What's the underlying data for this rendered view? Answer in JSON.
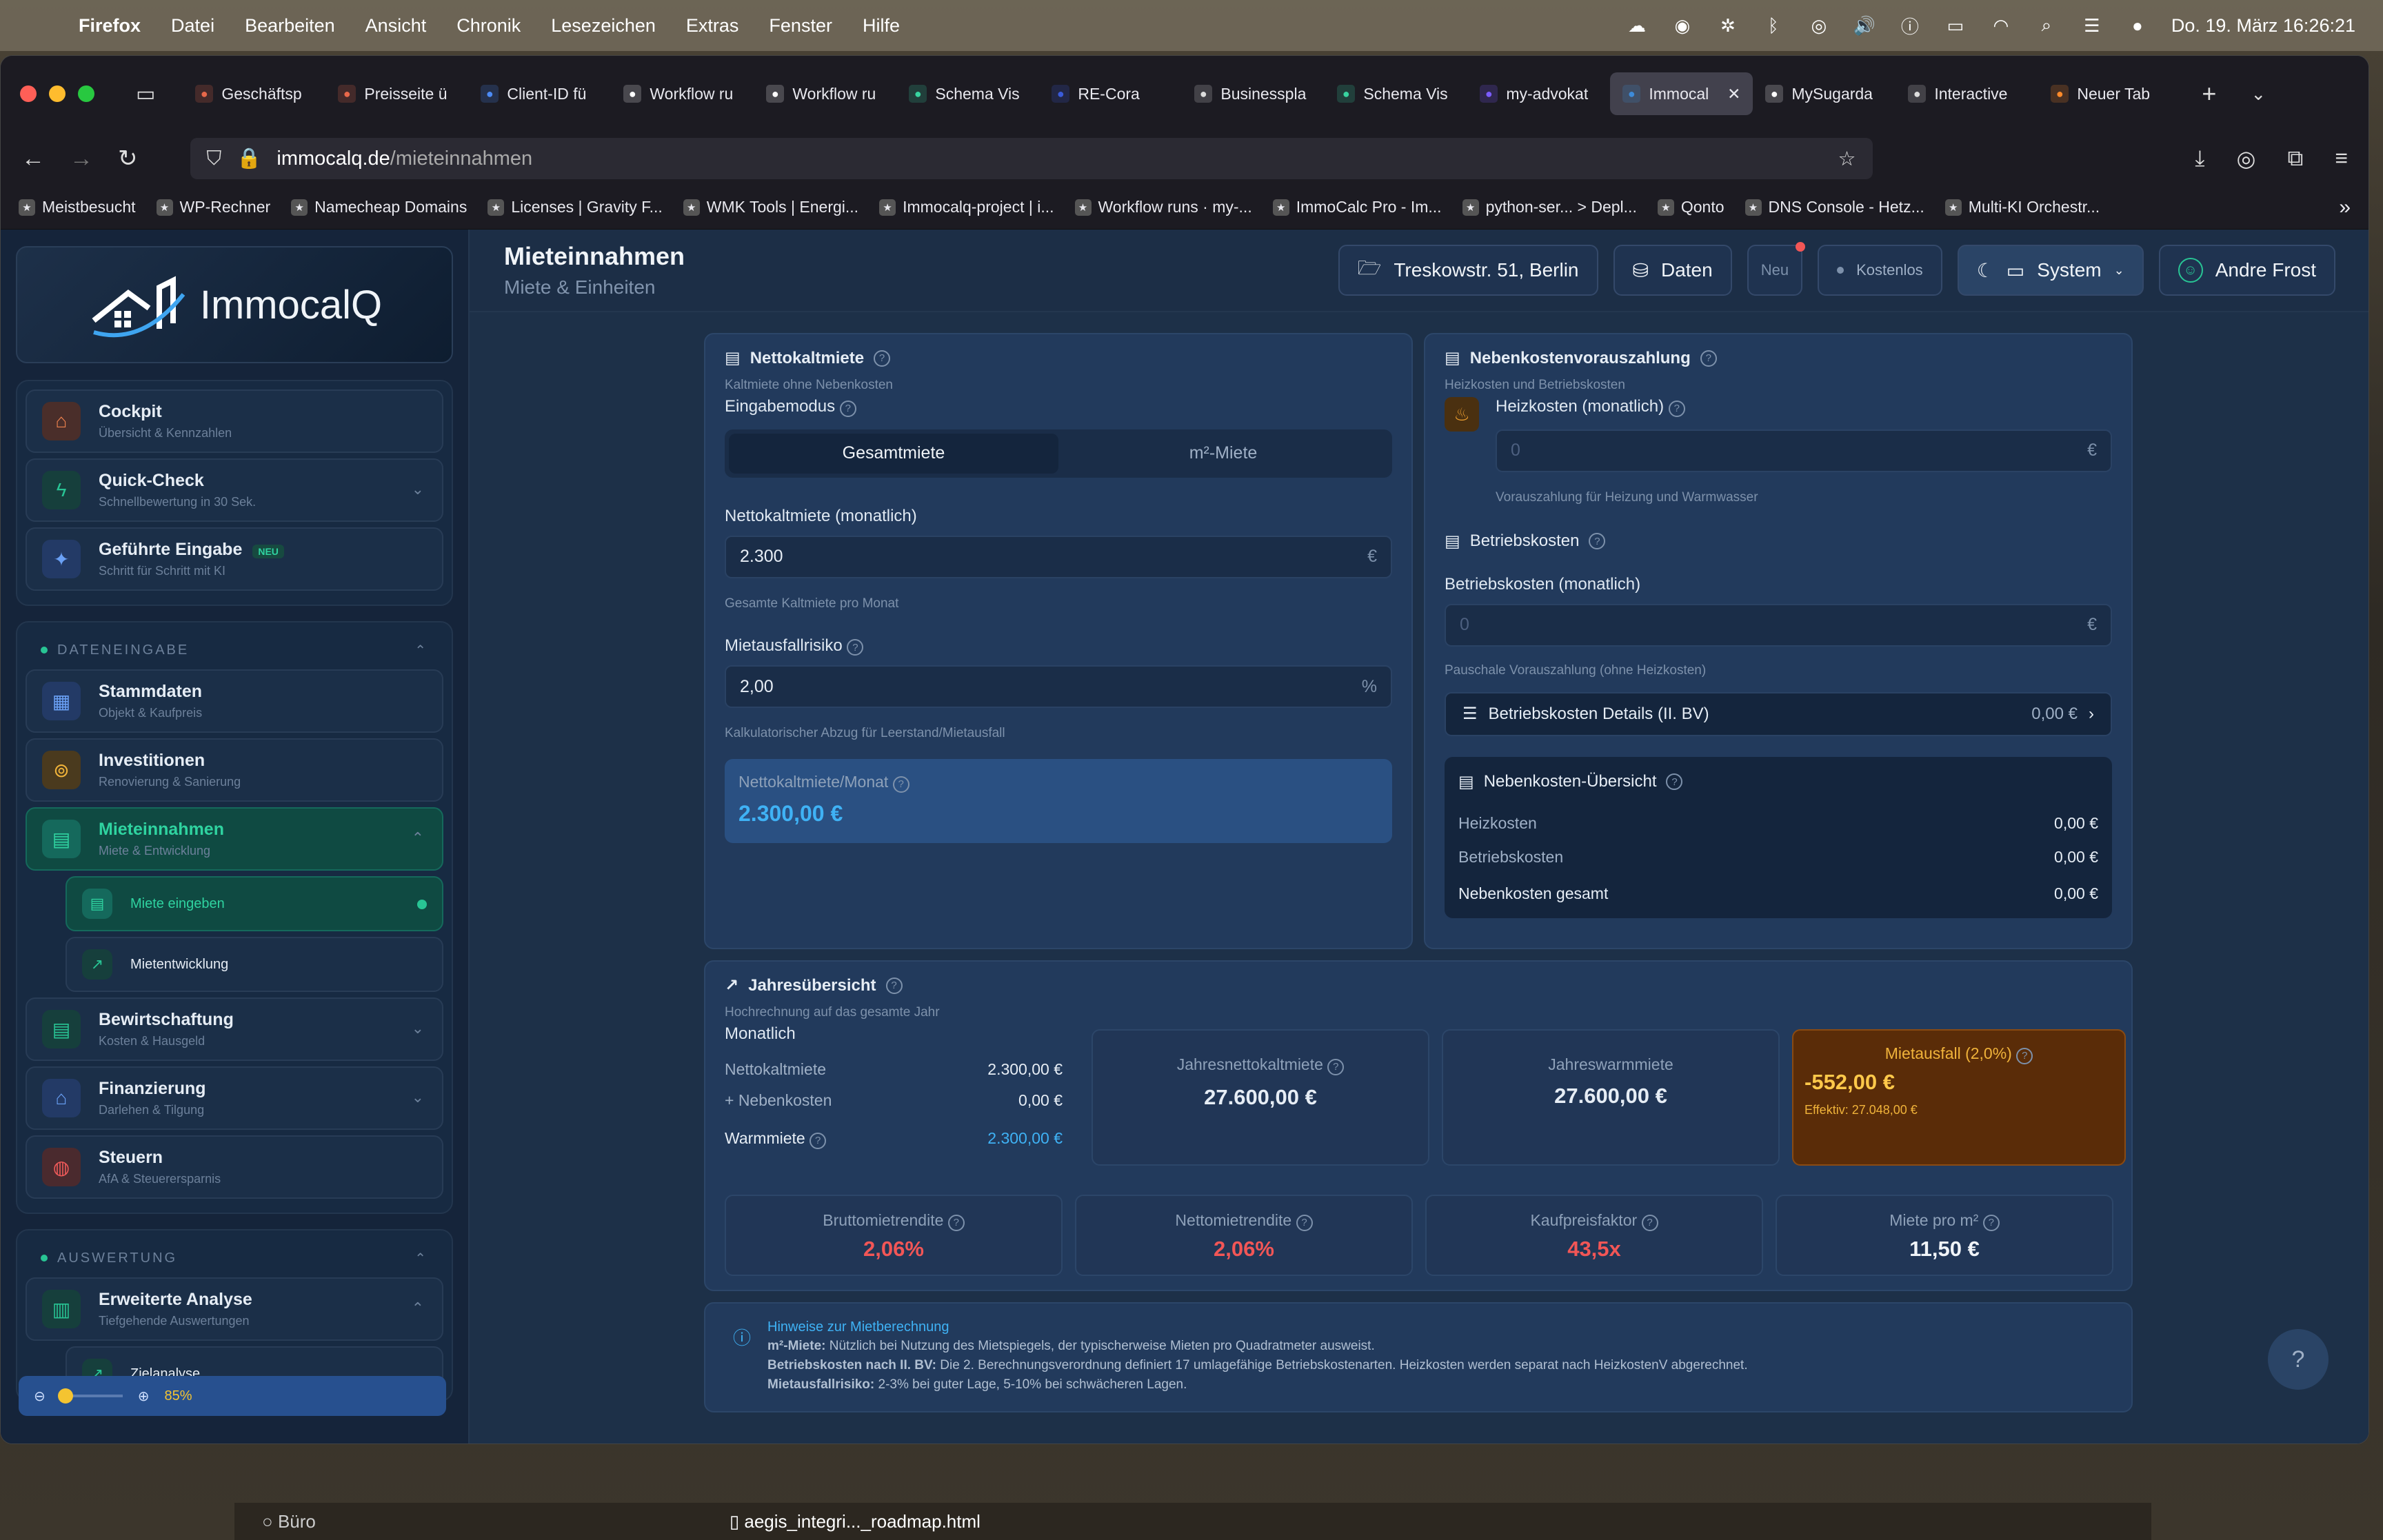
{
  "menubar": {
    "app": "Firefox",
    "items": [
      "Datei",
      "Bearbeiten",
      "Ansicht",
      "Chronik",
      "Lesezeichen",
      "Extras",
      "Fenster",
      "Hilfe"
    ],
    "clock": "Do. 19. März  16:26:21"
  },
  "tabs": [
    {
      "label": "Geschäftsp",
      "color": "#e8684a"
    },
    {
      "label": "Preisseite ü",
      "color": "#e8684a"
    },
    {
      "label": "Client-ID fü",
      "color": "#4c8bf5"
    },
    {
      "label": "Workflow ru",
      "color": "#ffffff"
    },
    {
      "label": "Workflow ru",
      "color": "#ffffff"
    },
    {
      "label": "Schema Vis",
      "color": "#38d39f"
    },
    {
      "label": "RE-Cora",
      "color": "#3a5bd9"
    },
    {
      "label": "Businesspla",
      "color": "#dddddd"
    },
    {
      "label": "Schema Vis",
      "color": "#38d39f"
    },
    {
      "label": "my-advokat",
      "color": "#7b5cff"
    },
    {
      "label": "Immocal",
      "color": "#3d8bd9",
      "active": true
    },
    {
      "label": "MySugarda",
      "color": "#ffffff"
    },
    {
      "label": "Interactive",
      "color": "#dddddd"
    },
    {
      "label": "Neuer Tab",
      "color": "#ff8a2a"
    }
  ],
  "url": {
    "host": "immocalq.de",
    "path": "/mieteinnahmen"
  },
  "bookmarks": [
    "Meistbesucht",
    "WP-Rechner",
    "Namecheap Domains",
    "Licenses | Gravity F...",
    "WMK Tools | Energi...",
    "Immocalq-project | i...",
    "Workflow runs · my-...",
    "ImmoCalc Pro - Im...",
    "python-ser... > Depl...",
    "Qonto",
    "DNS Console - Hetz...",
    "Multi-KI Orchestr..."
  ],
  "sidebar": {
    "logo": "ImmocalQ",
    "top": [
      {
        "title": "Cockpit",
        "sub": "Übersicht & Kennzahlen"
      },
      {
        "title": "Quick-Check",
        "sub": "Schnellbewertung in 30 Sek."
      },
      {
        "title": "Geführte Eingabe",
        "sub": "Schritt für Schritt mit KI",
        "badge": "NEU"
      }
    ],
    "section1": "DATENEINGABE",
    "data": [
      {
        "title": "Stammdaten",
        "sub": "Objekt & Kaufpreis"
      },
      {
        "title": "Investitionen",
        "sub": "Renovierung & Sanierung"
      },
      {
        "title": "Mieteinnahmen",
        "sub": "Miete & Entwicklung"
      },
      {
        "title": "Bewirtschaftung",
        "sub": "Kosten & Hausgeld"
      },
      {
        "title": "Finanzierung",
        "sub": "Darlehen & Tilgung"
      },
      {
        "title": "Steuern",
        "sub": "AfA & Steuerersparnis"
      }
    ],
    "subs": [
      "Miete eingeben",
      "Mietentwicklung"
    ],
    "section2": "AUSWERTUNG",
    "analysis": {
      "title": "Erweiterte Analyse",
      "sub": "Tiefgehende Auswertungen"
    },
    "analysis_sub": "Zielanalyse",
    "zoom": "85%"
  },
  "header": {
    "title": "Mieteinnahmen",
    "subtitle": "Miete & Einheiten",
    "address": "Treskowstr. 51, Berlin",
    "daten": "Daten",
    "neu": "Neu",
    "plan": "Kostenlos",
    "theme": "System",
    "user": "Andre Frost"
  },
  "netto": {
    "title": "Nettokaltmiete",
    "sub": "Kaltmiete ohne Nebenkosten",
    "mode_label": "Eingabemodus",
    "mode_a": "Gesamtmiete",
    "mode_b": "m²-Miete",
    "rent_label": "Nettokaltmiete (monatlich)",
    "rent": "2.300",
    "rent_unit": "€",
    "rent_hint": "Gesamte Kaltmiete pro Monat",
    "risk_label": "Mietausfallrisiko",
    "risk": "2,00",
    "risk_unit": "%",
    "risk_hint": "Kalkulatorischer Abzug für Leerstand/Mietausfall",
    "result_label": "Nettokaltmiete/Monat",
    "result": "2.300,00 €"
  },
  "neben": {
    "title": "Nebenkostenvorauszahlung",
    "sub": "Heizkosten und Betriebskosten",
    "heat_label": "Heizkosten (monatlich)",
    "heat_ph": "0",
    "heat_unit": "€",
    "heat_hint": "Vorauszahlung für Heizung und Warmwasser",
    "betr_title": "Betriebskosten",
    "betr_label": "Betriebskosten (monatlich)",
    "betr_ph": "0",
    "betr_unit": "€",
    "betr_hint": "Pauschale Vorauszahlung (ohne Heizkosten)",
    "details": "Betriebskosten Details (II. BV)",
    "details_val": "0,00 €",
    "ov_title": "Nebenkosten-Übersicht",
    "ov_rows": [
      {
        "k": "Heizkosten",
        "v": "0,00 €"
      },
      {
        "k": "Betriebskosten",
        "v": "0,00 €"
      }
    ],
    "ov_total_k": "Nebenkosten gesamt",
    "ov_total_v": "0,00 €"
  },
  "jahr": {
    "title": "Jahresübersicht",
    "sub": "Hochrechnung auf das gesamte Jahr",
    "monthly": "Monatlich",
    "rows": [
      {
        "k": "Nettokaltmiete",
        "v": "2.300,00 €"
      },
      {
        "k": "+ Nebenkosten",
        "v": "0,00 €"
      }
    ],
    "warm_k": "Warmmiete",
    "warm_v": "2.300,00 €",
    "b1_label": "Jahresnettokaltmiete",
    "b1_val": "27.600,00 €",
    "b2_label": "Jahreswarmmiete",
    "b2_val": "27.600,00 €",
    "b3_label": "Mietausfall (2,0%)",
    "b3_val": "-552,00 €",
    "b3_eff": "Effektiv: 27.048,00 €",
    "k": [
      {
        "label": "Bruttomietrendite",
        "val": "2,06%",
        "color": "#f25656"
      },
      {
        "label": "Nettomietrendite",
        "val": "2,06%",
        "color": "#f25656"
      },
      {
        "label": "Kaufpreisfaktor",
        "val": "43,5x",
        "color": "#f25656"
      },
      {
        "label": "Miete pro m²",
        "val": "11,50 €",
        "color": "#f0f4f8"
      }
    ]
  },
  "hints": {
    "title": "Hinweise zur Mietberechnung",
    "l1b": "m²-Miete:",
    "l1": " Nützlich bei Nutzung des Mietspiegels, der typischerweise Mieten pro Quadratmeter ausweist.",
    "l2b": "Betriebskosten nach II. BV:",
    "l2": " Die 2. Berechnungsverordnung definiert 17 umlagefähige Betriebskostenarten. Heizkosten werden separat nach HeizkostenV abgerechnet.",
    "l3b": "Mietausfallrisiko:",
    "l3": " 2-3% bei guter Lage, 5-10% bei schwächeren Lagen."
  },
  "help": "?",
  "dock": {
    "left": "Büro",
    "file": "aegis_integri..._roadmap.html"
  }
}
